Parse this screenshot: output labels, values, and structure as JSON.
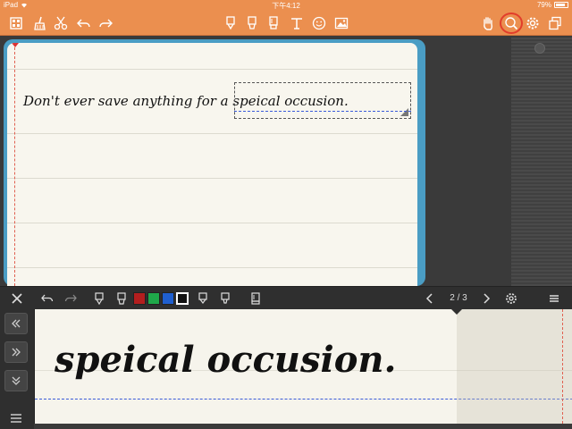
{
  "status_bar": {
    "device": "iPad",
    "time": "下午4:12",
    "battery": "79%"
  },
  "toolbar": {
    "left_icons": [
      "page-grid-icon",
      "broom-icon",
      "scissors-icon",
      "undo-icon",
      "redo-icon"
    ],
    "center_icons": [
      "pen-icon",
      "highlighter-icon",
      "marker-icon",
      "text-tool-icon",
      "emoji-icon",
      "image-icon"
    ],
    "right_icons": [
      "hand-icon",
      "zoom-icon",
      "gear-icon",
      "copy-pages-icon"
    ],
    "active_tool": "zoom-icon",
    "accent_color": "#eb8f4f",
    "highlight_color": "#e23d2b"
  },
  "note": {
    "handwriting": "Don't ever save anything for a speical occusion.",
    "paper_color": "#f8f6ee",
    "frame_color": "#4a9dc4"
  },
  "zoom_panel": {
    "page_indicator": "2 / 3",
    "zoomed_text": "speical occusion.",
    "colors": [
      "#b31e1e",
      "#1fa84a",
      "#1f5fcf",
      "#111111"
    ],
    "selected_color": "#111111"
  }
}
